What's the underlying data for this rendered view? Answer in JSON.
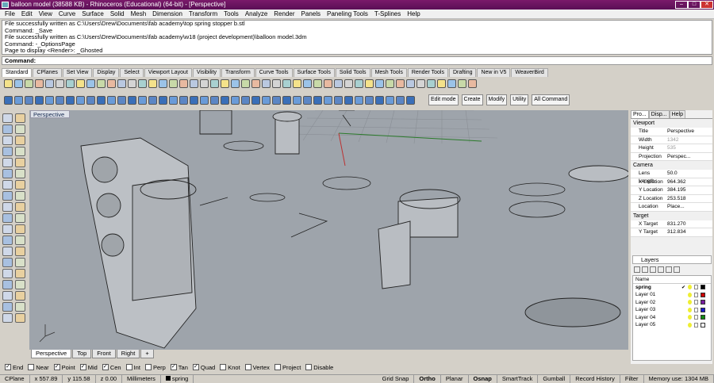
{
  "window": {
    "title": "balloon model (38588 KB) - Rhinoceros (Educational) (64-bit) - [Perspective]"
  },
  "menu": [
    "File",
    "Edit",
    "View",
    "Curve",
    "Surface",
    "Solid",
    "Mesh",
    "Dimension",
    "Transform",
    "Tools",
    "Analyze",
    "Render",
    "Panels",
    "Paneling Tools",
    "T-Splines",
    "Help"
  ],
  "history": [
    "File successfully written as C:\\Users\\Drew\\Documents\\fab academy\\top spring stopper b.stl",
    "Command: _Save",
    "File successfully written as C:\\Users\\Drew\\Documents\\fab academy\\w18 (project development)\\balloon model.3dm",
    "Command: -_OptionsPage",
    "Page to display <Render>: _Ghosted"
  ],
  "command": {
    "label": "Command:"
  },
  "toolbar_tabs": [
    "Standard",
    "CPlanes",
    "Set View",
    "Display",
    "Select",
    "Viewport Layout",
    "Visibility",
    "Transform",
    "Curve Tools",
    "Surface Tools",
    "Solid Tools",
    "Mesh Tools",
    "Render Tools",
    "Drafting",
    "New in V5",
    "WeaverBird"
  ],
  "tsplines": {
    "edit_mode": "Edit mode",
    "create": "Create",
    "modify": "Modify",
    "utility": "Utility",
    "all_command": "All Command"
  },
  "viewport": {
    "title": "Perspective"
  },
  "view_tabs": [
    "Perspective",
    "Top",
    "Front",
    "Right"
  ],
  "osnaps": [
    {
      "label": "End",
      "checked": true
    },
    {
      "label": "Near",
      "checked": false
    },
    {
      "label": "Point",
      "checked": true
    },
    {
      "label": "Mid",
      "checked": true
    },
    {
      "label": "Cen",
      "checked": true
    },
    {
      "label": "Int",
      "checked": false
    },
    {
      "label": "Perp",
      "checked": false
    },
    {
      "label": "Tan",
      "checked": true
    },
    {
      "label": "Quad",
      "checked": true
    },
    {
      "label": "Knot",
      "checked": false
    },
    {
      "label": "Vertex",
      "checked": false
    },
    {
      "label": "Project",
      "checked": false
    },
    {
      "label": "Disable",
      "checked": false
    }
  ],
  "status": {
    "cplane": "CPlane",
    "x": "x 557.89",
    "y": "y 115.58",
    "z": "z 0.00",
    "units": "Millimeters",
    "layer": "spring",
    "grid_snap": "Grid Snap",
    "ortho": "Ortho",
    "planar": "Planar",
    "osnap": "Osnap",
    "smarttrack": "SmartTrack",
    "gumball": "Gumball",
    "record_history": "Record History",
    "filter": "Filter",
    "memory": "Memory use: 1304 MB"
  },
  "properties": {
    "tabs": [
      "Pro...",
      "Disp...",
      "Help"
    ],
    "viewport_section": "Viewport",
    "viewport_rows": [
      {
        "k": "Title",
        "v": "Perspective",
        "disabled": false
      },
      {
        "k": "Width",
        "v": "1342",
        "disabled": true
      },
      {
        "k": "Height",
        "v": "535",
        "disabled": true
      },
      {
        "k": "Projection",
        "v": "Perspec...",
        "disabled": false
      }
    ],
    "camera_section": "Camera",
    "camera_rows": [
      {
        "k": "Lens Length",
        "v": "50.0"
      },
      {
        "k": "X Location",
        "v": "964.362"
      },
      {
        "k": "Y Location",
        "v": "384.195"
      },
      {
        "k": "Z Location",
        "v": "253.518"
      },
      {
        "k": "Location",
        "v": "Place..."
      }
    ],
    "target_section": "Target",
    "target_rows": [
      {
        "k": "X Target",
        "v": "831.270"
      },
      {
        "k": "Y Target",
        "v": "312.834"
      }
    ]
  },
  "layers": {
    "title": "Layers",
    "header": "Name",
    "rows": [
      {
        "name": "spring",
        "color": "#000000",
        "current": true
      },
      {
        "name": "Layer 01",
        "color": "#cc0000",
        "current": false
      },
      {
        "name": "Layer 02",
        "color": "#7a1fa0",
        "current": false
      },
      {
        "name": "Layer 03",
        "color": "#1a1acc",
        "current": false
      },
      {
        "name": "Layer 04",
        "color": "#138a13",
        "current": false
      },
      {
        "name": "Layer 05",
        "color": "#ffffff",
        "current": false
      }
    ]
  }
}
